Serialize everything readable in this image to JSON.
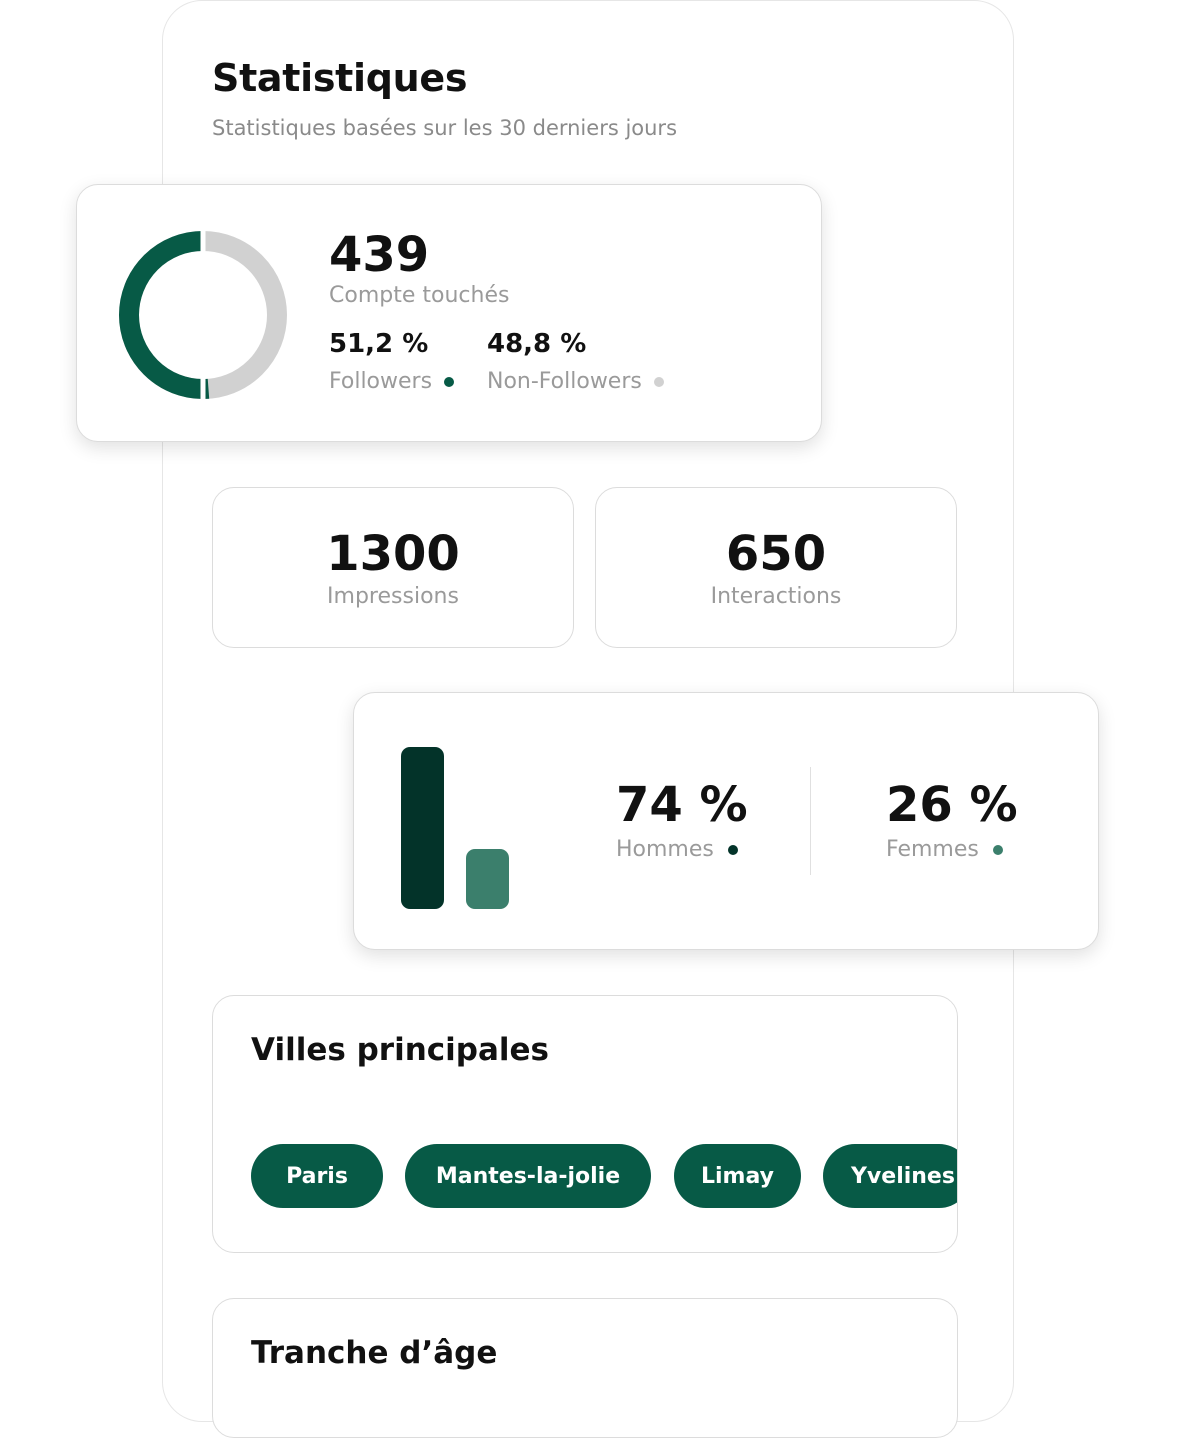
{
  "header": {
    "title": "Statistiques",
    "subtitle": "Statistiques basées sur les 30 derniers jours"
  },
  "reach": {
    "value": "439",
    "label": "Compte touchés",
    "followers": {
      "percent": "51,2 %",
      "label": "Followers",
      "fraction": 0.512,
      "color": "#075a46"
    },
    "non_followers": {
      "percent": "48,8 %",
      "label": "Non-Followers",
      "fraction": 0.488,
      "color": "#d1d1d1"
    }
  },
  "metrics": {
    "impressions": {
      "value": "1300",
      "label": "Impressions"
    },
    "interactions": {
      "value": "650",
      "label": "Interactions"
    }
  },
  "gender": {
    "men": {
      "percent": "74 %",
      "label": "Hommes",
      "fraction": 0.74,
      "color": "#033329"
    },
    "women": {
      "percent": "26 %",
      "label": "Femmes",
      "fraction": 0.26,
      "color": "#3b7f6c"
    }
  },
  "cities": {
    "title": "Villes principales",
    "items": [
      "Paris",
      "Mantes-la-jolie",
      "Limay",
      "Yvelines"
    ]
  },
  "age": {
    "title": "Tranche d’âge"
  }
}
